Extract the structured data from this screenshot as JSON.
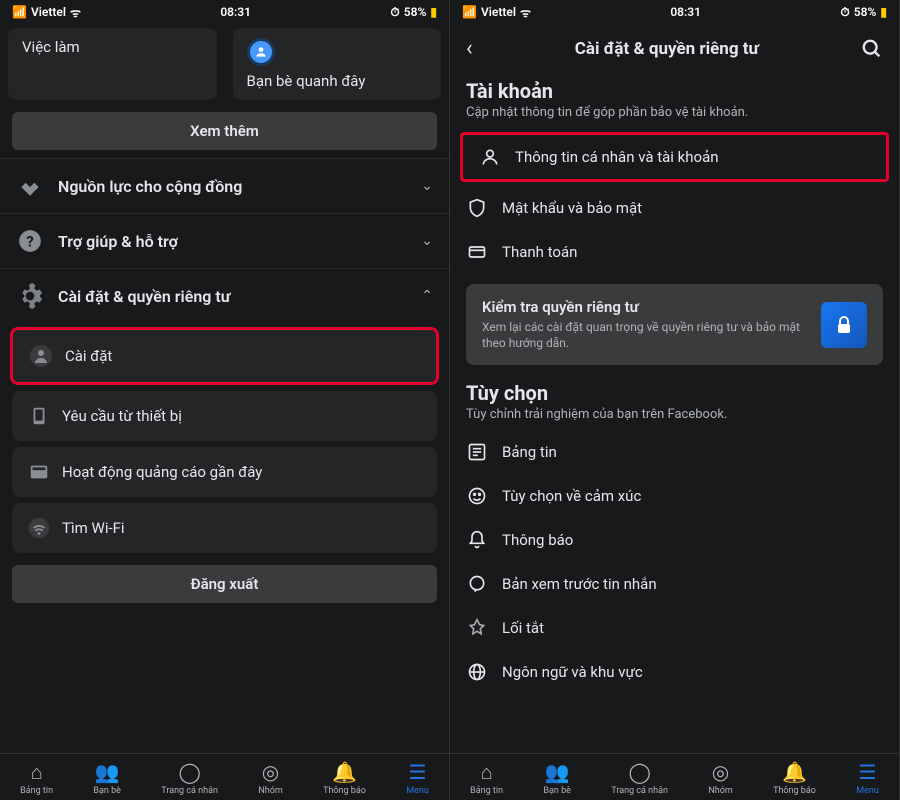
{
  "status": {
    "carrier": "Viettel",
    "time": "08:31",
    "battery": "58%"
  },
  "left": {
    "chips": {
      "jobs": "Việc làm",
      "nearby": "Bạn bè quanh đây"
    },
    "see_more": "Xem thêm",
    "sections": {
      "community": "Nguồn lực cho cộng đồng",
      "help": "Trợ giúp & hỗ trợ",
      "settings_privacy": "Cài đặt & quyền riêng tư"
    },
    "cards": {
      "settings": "Cài đặt",
      "device": "Yêu cầu từ thiết bị",
      "ads": "Hoạt động quảng cáo gần đây",
      "wifi": "Tìm Wi-Fi"
    },
    "logout": "Đăng xuất"
  },
  "right": {
    "header": "Cài đặt & quyền riêng tư",
    "account": {
      "title": "Tài khoản",
      "sub": "Cập nhật thông tin để góp phần bảo vệ tài khoản.",
      "personal": "Thông tin cá nhân và tài khoản",
      "security": "Mật khẩu và bảo mật",
      "payment": "Thanh toán"
    },
    "privacy": {
      "title": "Kiểm tra quyền riêng tư",
      "sub": "Xem lại các cài đặt quan trọng về quyền riêng tư và bảo mật theo hướng dẫn."
    },
    "options": {
      "title": "Tùy chọn",
      "sub": "Tùy chỉnh trải nghiệm của bạn trên Facebook.",
      "feed": "Bảng tin",
      "reactions": "Tùy chọn về cảm xúc",
      "notifications": "Thông báo",
      "message_preview": "Bản xem trước tin nhắn",
      "shortcuts": "Lối tắt",
      "language": "Ngôn ngữ và khu vực"
    }
  },
  "nav": {
    "feed": "Bảng tin",
    "friends": "Bạn bè",
    "profile": "Trang cá nhân",
    "groups": "Nhóm",
    "notifications": "Thông báo",
    "menu": "Menu"
  }
}
